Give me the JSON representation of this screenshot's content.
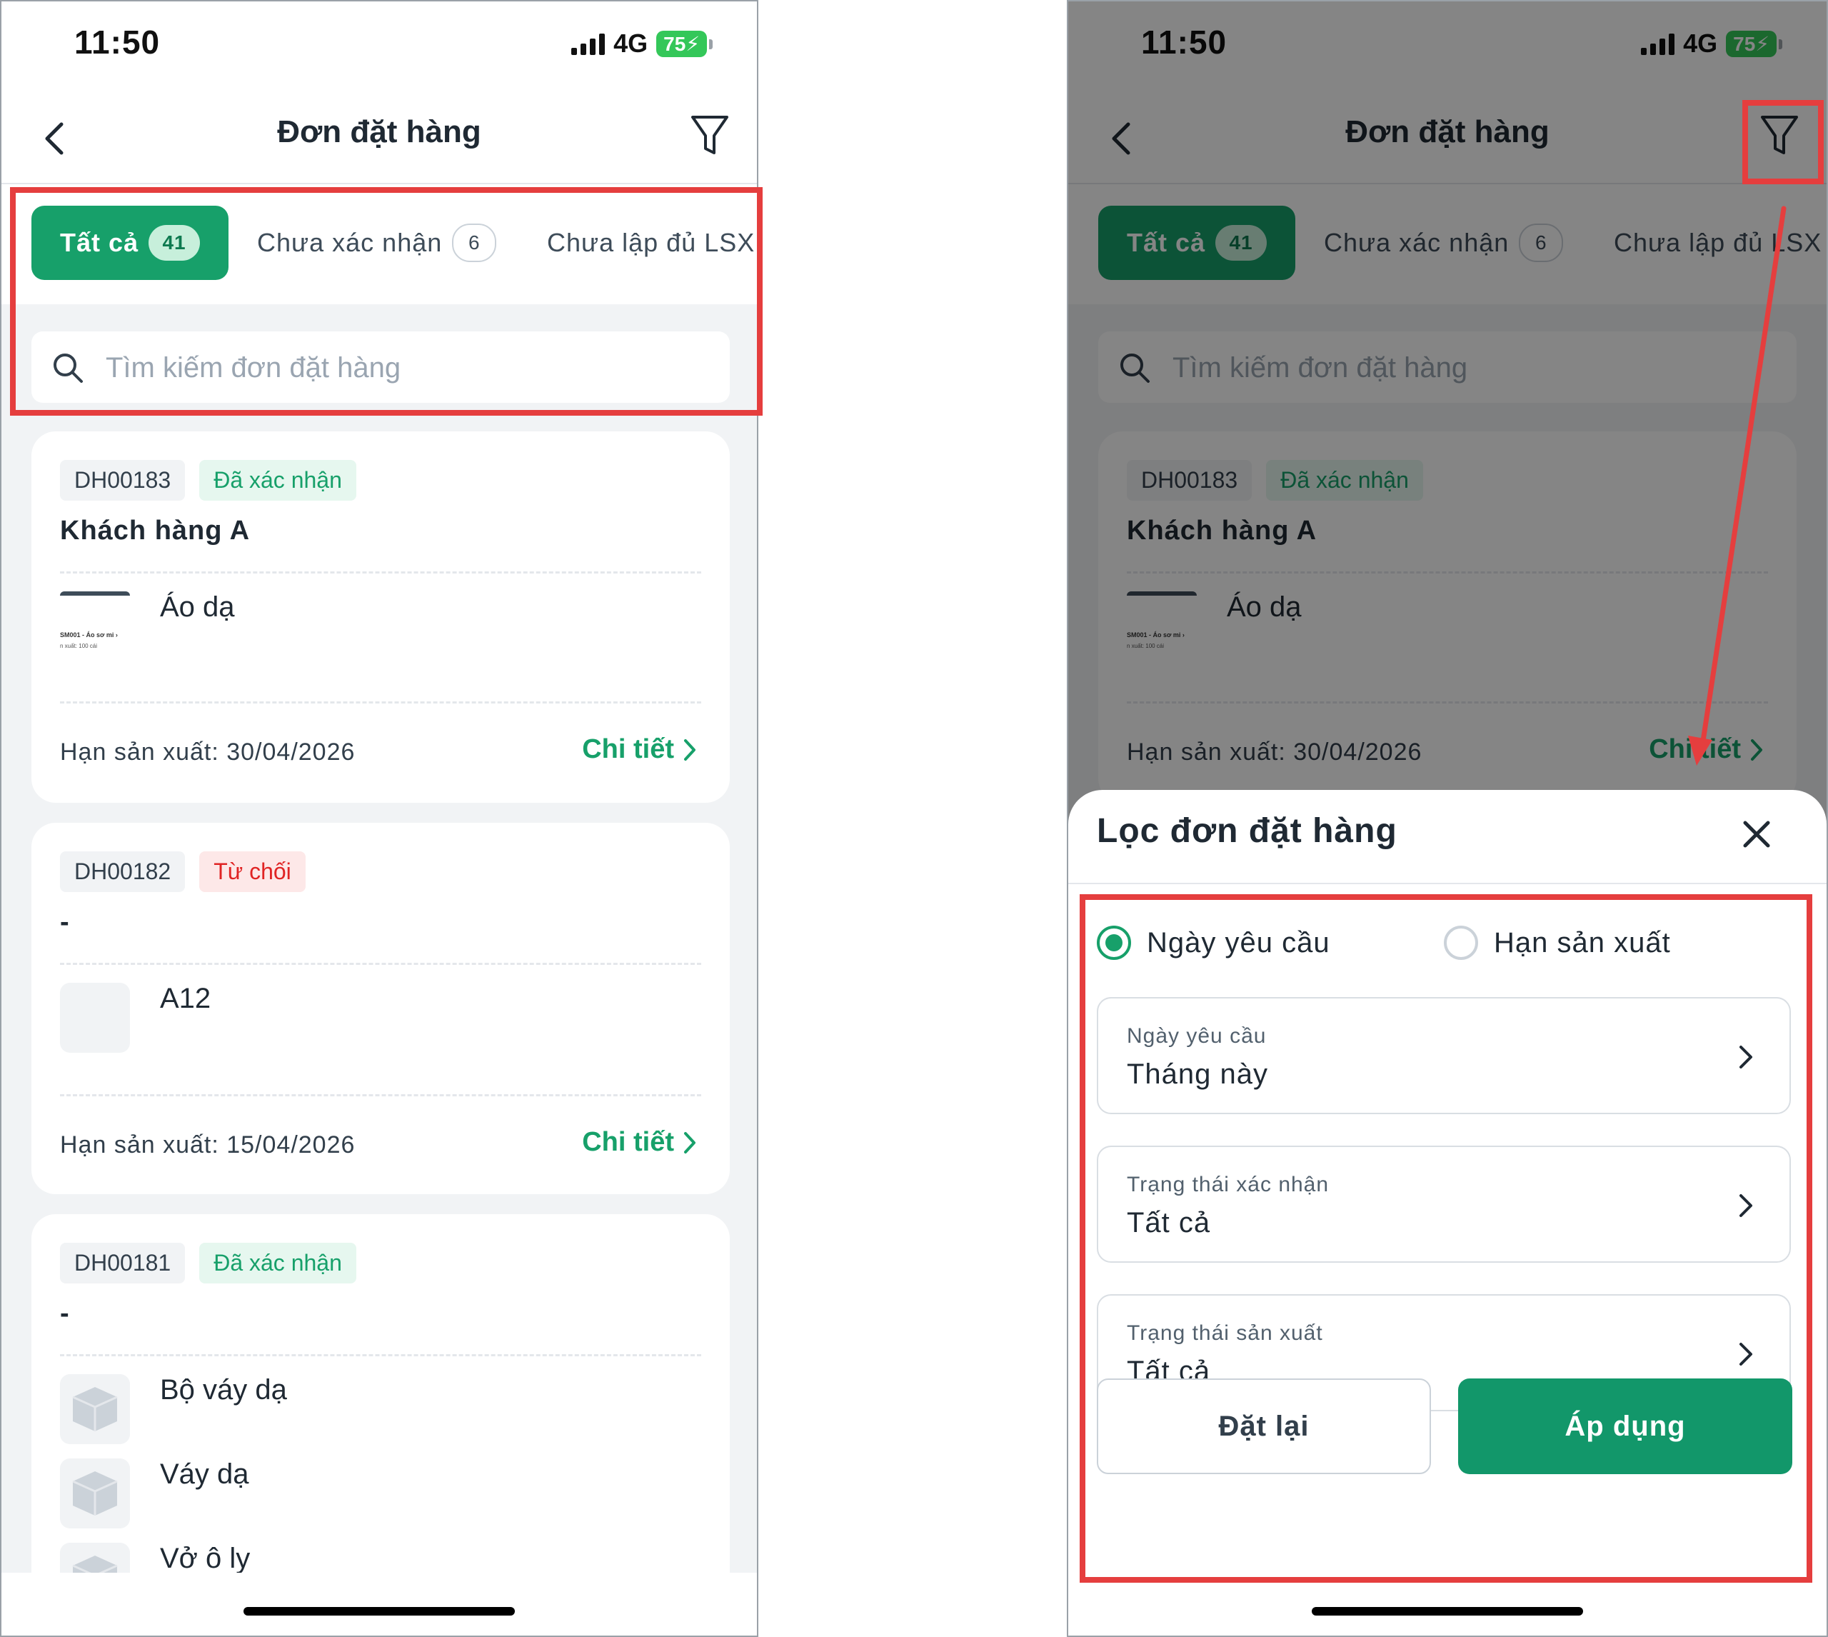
{
  "status": {
    "time": "11:50",
    "network": "4G",
    "battery": "75"
  },
  "header": {
    "title": "Đơn đặt hàng"
  },
  "tabs": [
    {
      "label": "Tất cả",
      "count": "41"
    },
    {
      "label": "Chưa xác nhận",
      "count": "6"
    },
    {
      "label": "Chưa lập đủ LSX"
    }
  ],
  "search": {
    "placeholder": "Tìm kiếm đơn đặt hàng"
  },
  "orders": [
    {
      "code": "DH00183",
      "status": "Đã xác nhận",
      "customer": "Khách hàng A",
      "items": [
        {
          "name": "Áo dạ",
          "thumb_line1": "SM001 - Áo sơ mi ›",
          "thumb_line2": "n xuất: 100 cái"
        }
      ],
      "deadline": "Hạn sản xuất: 30/04/2026",
      "detail_label": "Chi tiết"
    },
    {
      "code": "DH00182",
      "status": "Từ chối",
      "customer": "-",
      "items": [
        {
          "name": "A12"
        }
      ],
      "deadline": "Hạn sản xuất: 15/04/2026",
      "detail_label": "Chi tiết"
    },
    {
      "code": "DH00181",
      "status": "Đã xác nhận",
      "customer": "-",
      "items": [
        {
          "name": "Bộ váy dạ"
        },
        {
          "name": "Váy dạ"
        },
        {
          "name": "Vở ô ly"
        }
      ]
    }
  ],
  "filter_sheet": {
    "title": "Lọc đơn đặt hàng",
    "radios": [
      {
        "label": "Ngày yêu cầu",
        "selected": true
      },
      {
        "label": "Hạn sản xuất",
        "selected": false
      }
    ],
    "fields": [
      {
        "label": "Ngày yêu cầu",
        "value": "Tháng này"
      },
      {
        "label": "Trạng thái xác nhận",
        "value": "Tất cả"
      },
      {
        "label": "Trạng thái sản xuất",
        "value": "Tất cả"
      }
    ],
    "reset_label": "Đặt lại",
    "apply_label": "Áp dụng"
  },
  "colors": {
    "accent": "#17a06a",
    "annotation": "#e53e3e",
    "reject": "#e02424"
  },
  "icons": [
    "back-chevron-icon",
    "filter-funnel-icon",
    "search-icon",
    "close-icon",
    "chevron-right-icon",
    "package-box-icon"
  ]
}
